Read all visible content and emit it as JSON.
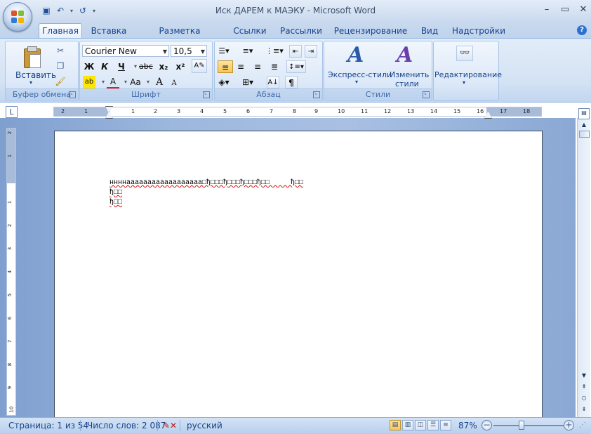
{
  "window": {
    "title": "Иск ДАРЕМ к МАЭКУ - Microsoft Word",
    "controls": {
      "minimize": "–",
      "maximize": "▭",
      "close": "✕"
    }
  },
  "quick_access": {
    "save_icon": "💾",
    "undo_icon": "↶",
    "redo_icon": "↺",
    "customize_icon": "▾"
  },
  "tabs": [
    {
      "label": "Главная",
      "active": true
    },
    {
      "label": "Вставка"
    },
    {
      "label": "Разметка страницы"
    },
    {
      "label": "Ссылки"
    },
    {
      "label": "Рассылки"
    },
    {
      "label": "Рецензирование"
    },
    {
      "label": "Вид"
    },
    {
      "label": "Надстройки"
    }
  ],
  "ribbon": {
    "clipboard": {
      "label": "Буфер обмена",
      "paste_label": "Вставить",
      "paste_arrow": "▾"
    },
    "font": {
      "label": "Шрифт",
      "font_name": "Courier New",
      "font_size": "10,5",
      "bold": "Ж",
      "italic": "К",
      "underline": "Ч",
      "strike": "abc",
      "subscript": "x₂",
      "superscript": "x²",
      "change_case": "Aa",
      "grow": "A",
      "shrink": "A"
    },
    "paragraph": {
      "label": "Абзац",
      "show_marks": "¶"
    },
    "styles": {
      "label": "Стили",
      "express": "Экспресс-стили",
      "change_line1": "Изменить",
      "change_line2": "стили"
    },
    "editing": {
      "label": "Редактирование"
    }
  },
  "ruler": {
    "h_numbers": [
      "2",
      "1",
      "1",
      "2",
      "3",
      "4",
      "5",
      "6",
      "7",
      "8",
      "9",
      "10",
      "11",
      "12",
      "13",
      "14",
      "15",
      "16",
      "17",
      "18"
    ],
    "v_numbers": [
      "2",
      "1",
      "1",
      "2",
      "3",
      "4",
      "5",
      "6",
      "7",
      "8",
      "9",
      "10"
    ]
  },
  "document": {
    "lines": [
      "ннннаааааааааааааааааа□ђ□□□ђ□□□ђ□□□ђ□□     ђ□□",
      "ђ□□",
      "ђ□□"
    ]
  },
  "status": {
    "page": "Страница: 1 из 54",
    "words": "Число слов: 2 087",
    "language": "русский",
    "zoom": "87%",
    "zoom_level": 0.87
  }
}
